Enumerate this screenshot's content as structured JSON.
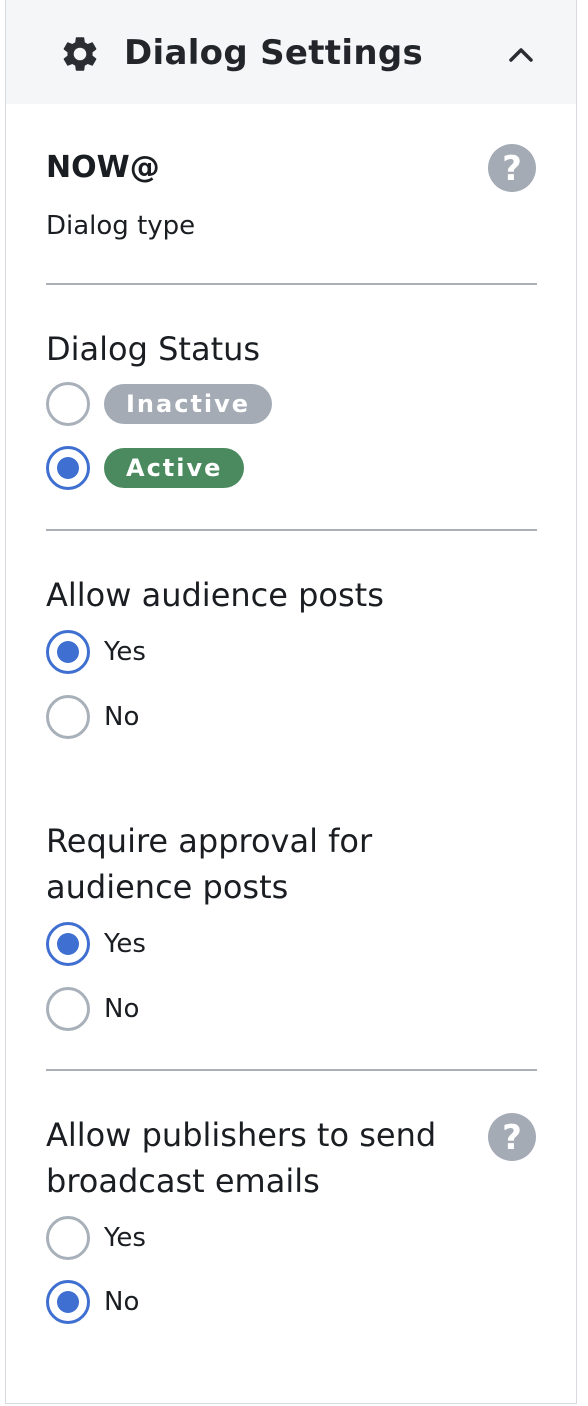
{
  "header": {
    "title": "Dialog Settings",
    "icon": "gear-icon",
    "collapse_icon": "chevron-up-icon"
  },
  "dialog": {
    "name": "NOW@",
    "type_label": "Dialog type",
    "help_icon": "help-icon"
  },
  "status": {
    "title": "Dialog Status",
    "options": [
      {
        "label": "Inactive",
        "checked": false,
        "color": "#a4abb5"
      },
      {
        "label": "Active",
        "checked": true,
        "color": "#4a8a5e"
      }
    ]
  },
  "audience_posts": {
    "title": "Allow audience posts",
    "options": [
      {
        "label": "Yes",
        "checked": true
      },
      {
        "label": "No",
        "checked": false
      }
    ]
  },
  "approval": {
    "title_line1": "Require approval for",
    "title_line2": "audience posts",
    "options": [
      {
        "label": "Yes",
        "checked": true
      },
      {
        "label": "No",
        "checked": false
      }
    ]
  },
  "broadcast": {
    "title_line1": "Allow publishers to send",
    "title_line2": "broadcast emails",
    "help_icon": "help-icon",
    "options": [
      {
        "label": "Yes",
        "checked": false
      },
      {
        "label": "No",
        "checked": true
      }
    ]
  },
  "colors": {
    "accent": "#3e6fd1",
    "header_bg": "#f5f6f8",
    "divider": "#a9b0b8",
    "help_icon": "#a4abb5"
  }
}
